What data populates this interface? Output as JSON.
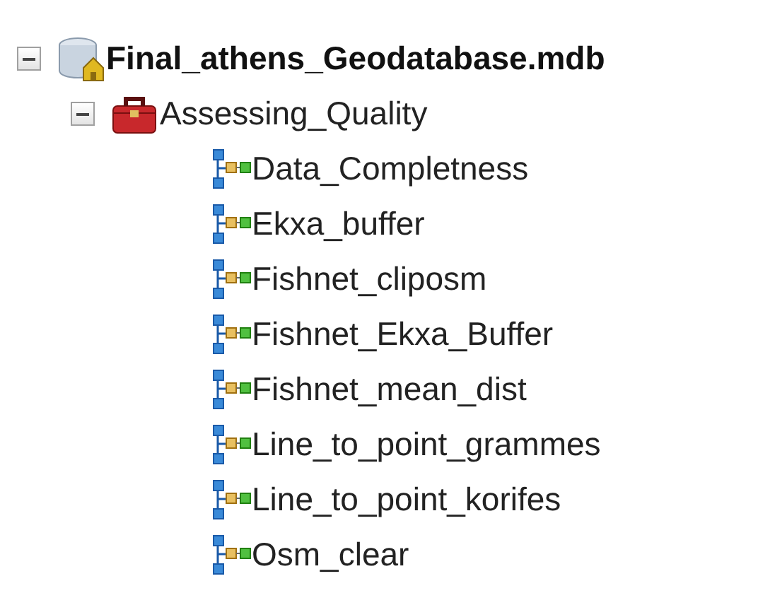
{
  "tree": [
    {
      "label": "Final_athens_Geodatabase.mdb",
      "kind": "database",
      "expanded": true,
      "children": [
        {
          "label": "Assessing_Quality",
          "kind": "toolbox",
          "expanded": true,
          "children": [
            {
              "label": "Data_Completness",
              "kind": "model"
            },
            {
              "label": "Ekxa_buffer",
              "kind": "model"
            },
            {
              "label": "Fishnet_cliposm",
              "kind": "model"
            },
            {
              "label": "Fishnet_Ekxa_Buffer",
              "kind": "model"
            },
            {
              "label": "Fishnet_mean_dist",
              "kind": "model"
            },
            {
              "label": "Line_to_point_grammes",
              "kind": "model"
            },
            {
              "label": "Line_to_point_korifes",
              "kind": "model"
            },
            {
              "label": "Osm_clear",
              "kind": "model"
            }
          ]
        }
      ]
    }
  ]
}
